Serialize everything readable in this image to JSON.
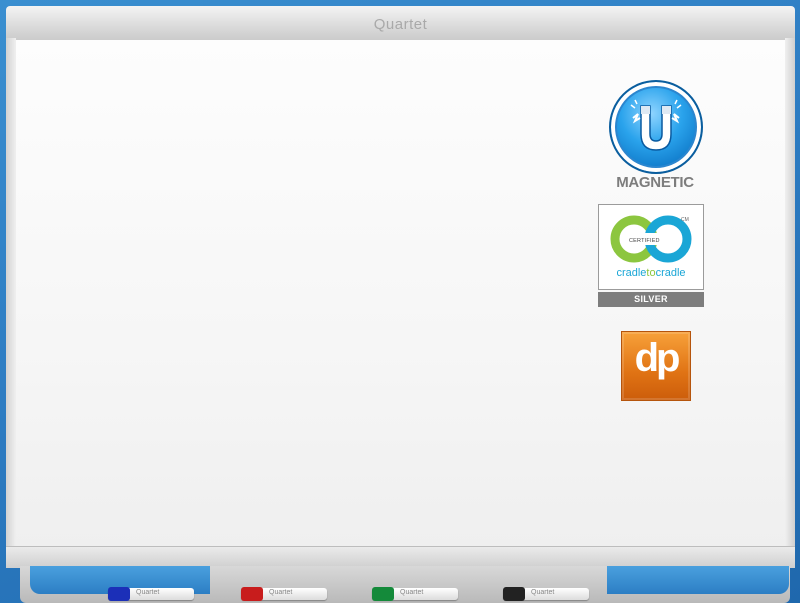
{
  "board": {
    "brand": "Quartet"
  },
  "badges": {
    "magnetic": {
      "label": "MAGNETIC",
      "icon": "magnet-icon"
    },
    "cradle": {
      "certified": "CERTIFIED",
      "tm": "CM",
      "word_left": "cradle",
      "word_mid": "to",
      "word_right": "cradle",
      "level": "SILVER"
    },
    "dp": {
      "label": "dp"
    }
  },
  "markers": [
    {
      "label": "Quartet",
      "color": "#1b2fb8"
    },
    {
      "label": "Quartet",
      "color": "#c81c1c"
    },
    {
      "label": "Quartet",
      "color": "#148a3a"
    },
    {
      "label": "Quartet",
      "color": "#222222"
    }
  ]
}
